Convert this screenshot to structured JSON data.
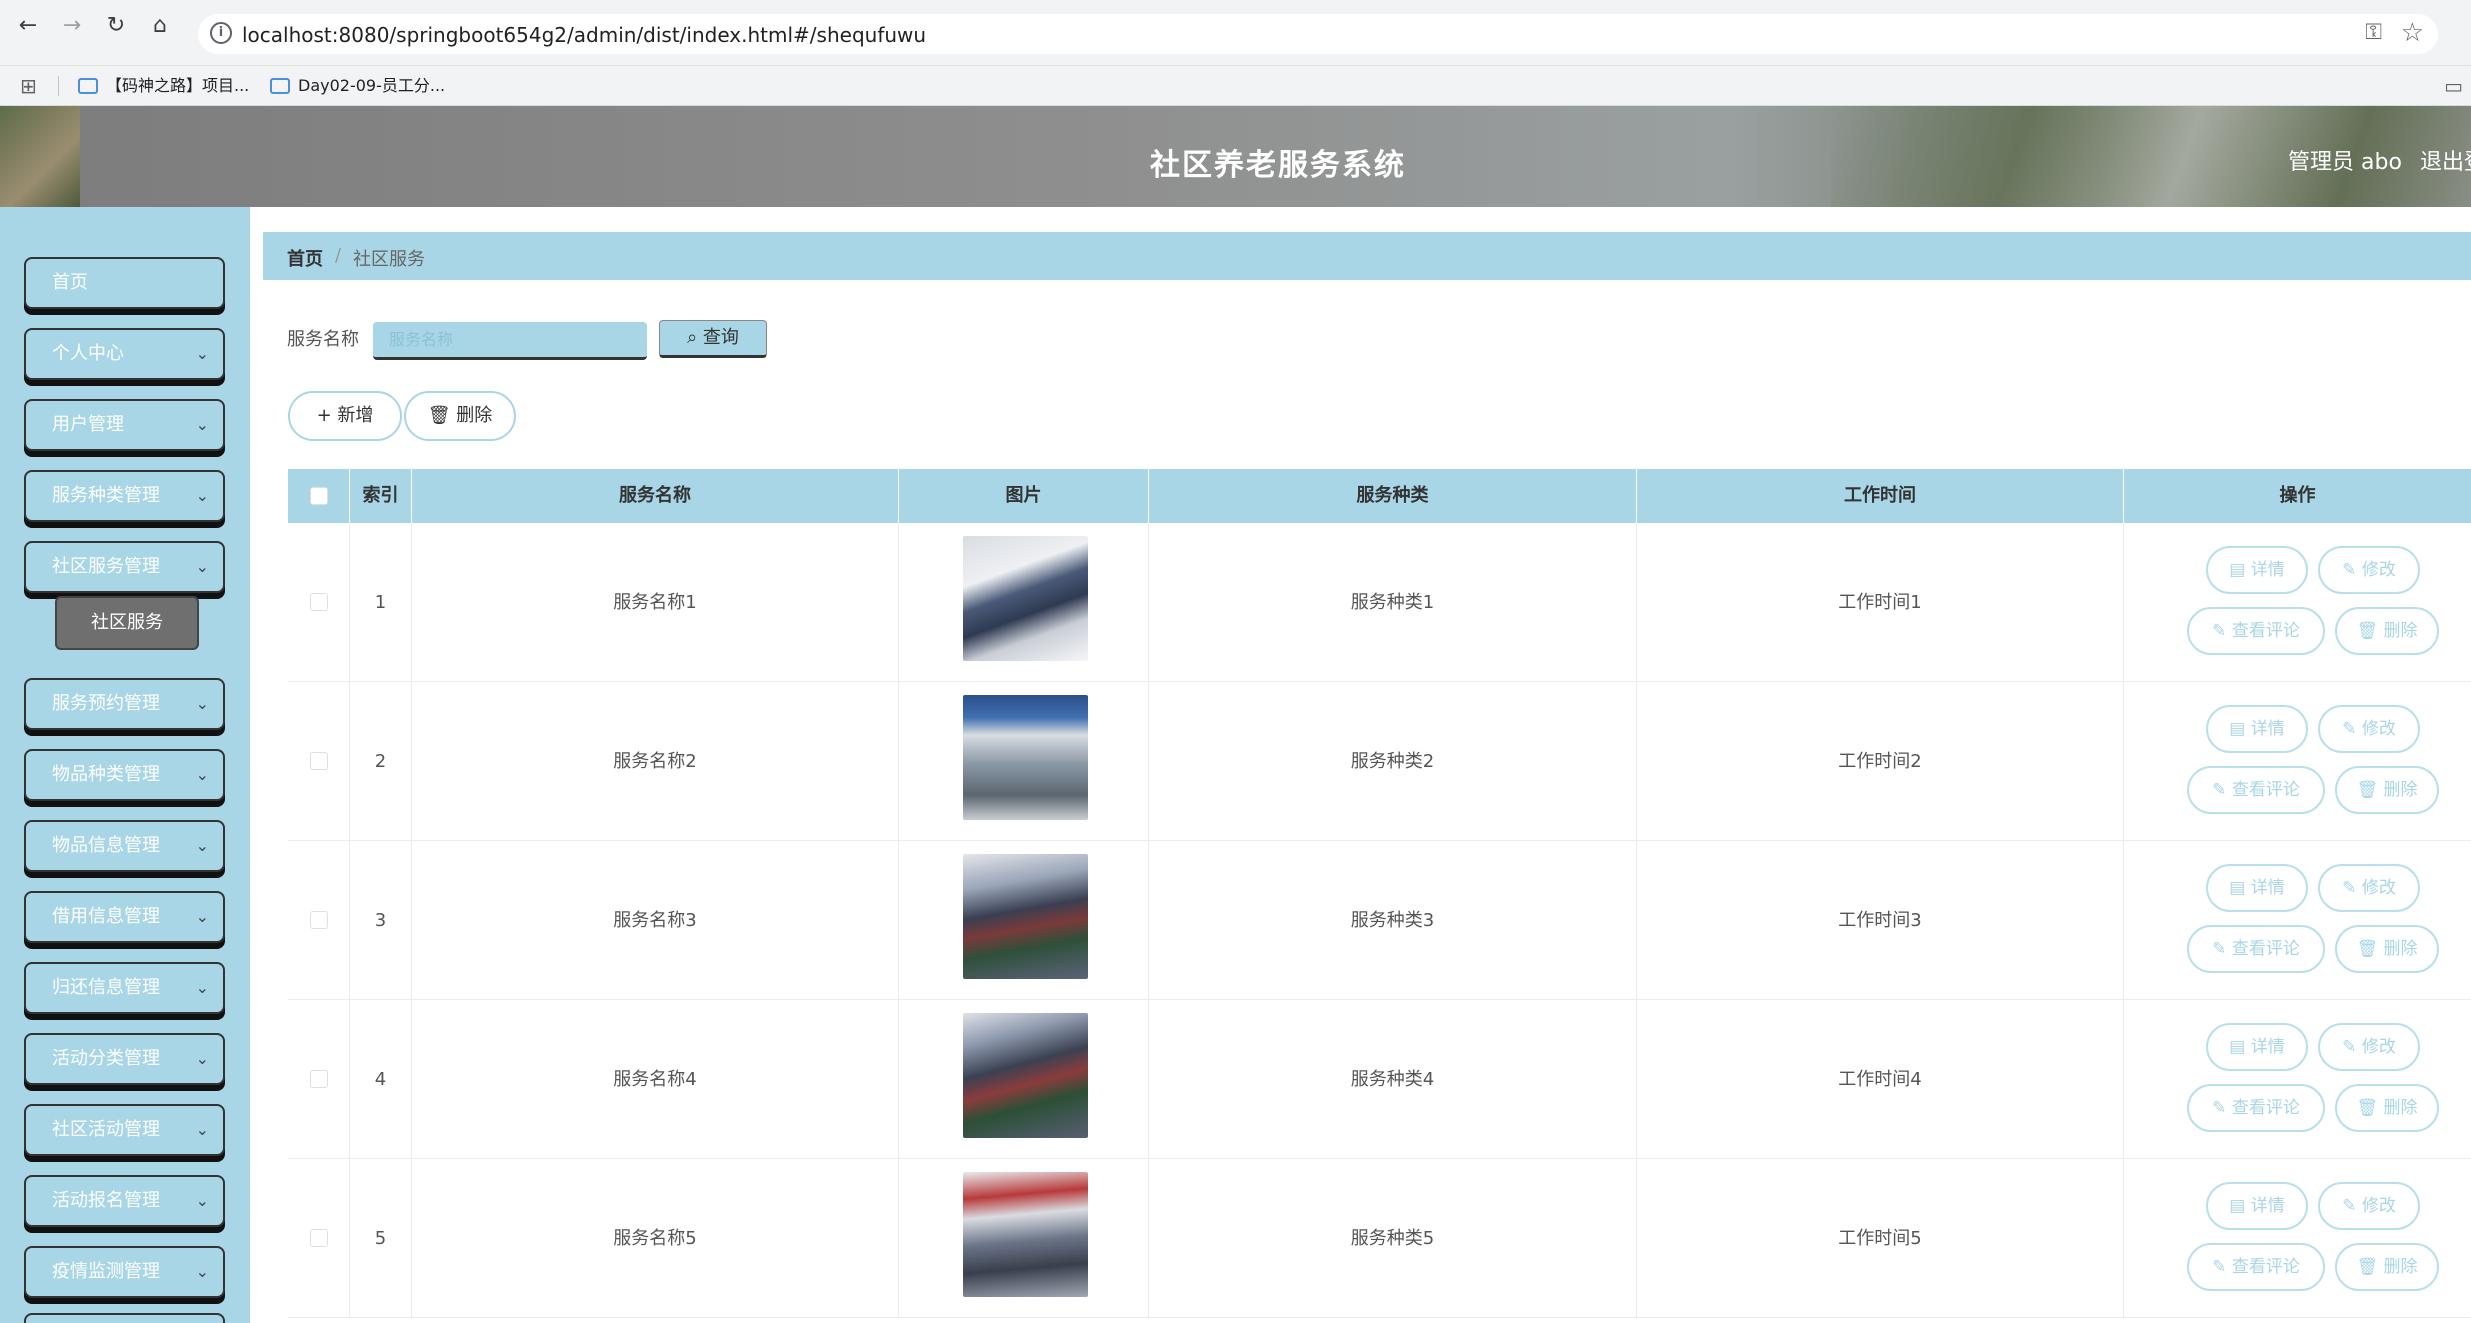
{
  "browser": {
    "url": "localhost:8080/springboot654g2/admin/dist/index.html#/shequfuwu",
    "bookmarks": [
      "【码神之路】项目...",
      "Day02-09-员工分..."
    ]
  },
  "header": {
    "title": "社区养老服务系统",
    "user": "管理员 abo",
    "logout": "退出登"
  },
  "sidebar": {
    "items": [
      {
        "label": "首页",
        "caret": ""
      },
      {
        "label": "个人中心",
        "caret": "⌄"
      },
      {
        "label": "用户管理",
        "caret": "⌄"
      },
      {
        "label": "服务种类管理",
        "caret": "⌄"
      },
      {
        "label": "社区服务管理",
        "caret": "⌄"
      },
      {
        "label": "服务预约管理",
        "caret": "⌄"
      },
      {
        "label": "物品种类管理",
        "caret": "⌄"
      },
      {
        "label": "物品信息管理",
        "caret": "⌄"
      },
      {
        "label": "借用信息管理",
        "caret": "⌄"
      },
      {
        "label": "归还信息管理",
        "caret": "⌄"
      },
      {
        "label": "活动分类管理",
        "caret": "⌄"
      },
      {
        "label": "社区活动管理",
        "caret": "⌄"
      },
      {
        "label": "活动报名管理",
        "caret": "⌄"
      },
      {
        "label": "疫情监测管理",
        "caret": "⌄"
      }
    ],
    "active_subitem": "社区服务"
  },
  "breadcrumb": {
    "home": "首页",
    "separator": "/",
    "current": "社区服务"
  },
  "search": {
    "label": "服务名称",
    "placeholder": "服务名称",
    "button": "查询"
  },
  "toolbar": {
    "add": "新增",
    "delete": "删除"
  },
  "table": {
    "columns": [
      "索引",
      "服务名称",
      "图片",
      "服务种类",
      "工作时间",
      "操作"
    ],
    "rows": [
      {
        "index": "1",
        "name": "服务名称1",
        "category": "服务种类1",
        "time": "工作时间1"
      },
      {
        "index": "2",
        "name": "服务名称2",
        "category": "服务种类2",
        "time": "工作时间2"
      },
      {
        "index": "3",
        "name": "服务名称3",
        "category": "服务种类3",
        "time": "工作时间3"
      },
      {
        "index": "4",
        "name": "服务名称4",
        "category": "服务种类4",
        "time": "工作时间4"
      },
      {
        "index": "5",
        "name": "服务名称5",
        "category": "服务种类5",
        "time": "工作时间5"
      }
    ],
    "actions": {
      "detail": "详情",
      "edit": "修改",
      "comments": "查看评论",
      "delete": "删除"
    }
  },
  "colors": {
    "accent": "#a8d6e6",
    "submenu_active": "#6f6f6f"
  }
}
